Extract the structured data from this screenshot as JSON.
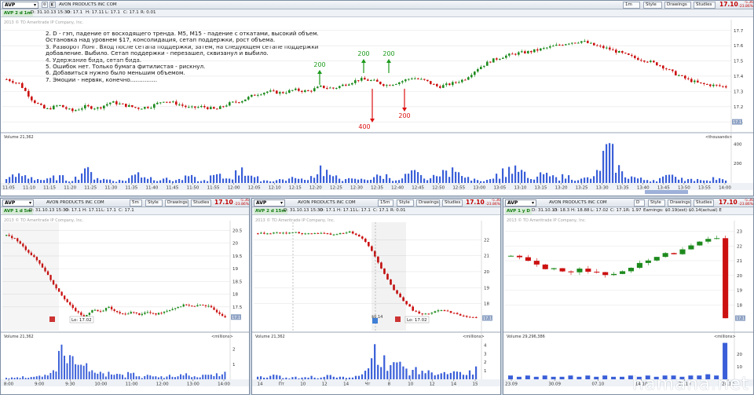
{
  "symbol": "AVP",
  "company": "AVON PRODUCTS INC COM",
  "last_price": "17.10",
  "change": "-5.36",
  "change_pct": "-23.86%",
  "toolbar": {
    "style_label": "Style",
    "drawings_label": "Drawings",
    "studies_label": "Studies"
  },
  "colors": {
    "up": "#1d8a1d",
    "down": "#cc1010",
    "volume": "#3a5fd8",
    "background": "#ffffff",
    "frame": "#c9d3df",
    "annotation_up": "#1a9a1a",
    "annotation_down": "#dd1111"
  },
  "icons": [
    "dropdown-icon",
    "settings-icon",
    "lock-icon",
    "maximize-icon",
    "close-icon",
    "earnings-marker-icon"
  ],
  "main_chart": {
    "timeframe_badge": "AVP 2 d 1m",
    "interval_label": "1m",
    "info": {
      "date": "D: 31.10.13 15:30",
      "open": "O: 17.1",
      "high": "H: 17.11",
      "low": "L: 17.1",
      "close": "C: 17.1",
      "range": "R: 0.01"
    },
    "watermark": "2013 © TD Ameritrade IP Company, Inc.",
    "notes": [
      "2. D - гэп, падение от восходящего тренда. M5, M15 - падение с откатами, высокий объем.",
      "Остановка над уровнем $17, консолидация, сетап поддержки, рост объема.",
      "3. Разворот Лонг. Вход после сетапа поддержки, затем, на следующем сетапе поддержки",
      "добавление. Выбило. Сетап поддержки - перезашел, сквизанул и выбило.",
      "4. Удержание бида, сетап бида.",
      "5. Ошибок нет. Только бумага фитилистая - рискнул.",
      "6. Добавиться нужно было меньшим объемом.",
      "7. Эмоции - нервяк, конечно..............."
    ],
    "annotations": [
      {
        "label": "200",
        "direction": "buy"
      },
      {
        "label": "200",
        "direction": "buy"
      },
      {
        "label": "200",
        "direction": "buy"
      },
      {
        "label": "400",
        "direction": "sell"
      },
      {
        "label": "200",
        "direction": "sell"
      }
    ],
    "volume_label": "Volume 21,362",
    "volume_units": "<thousands>"
  },
  "panel_a": {
    "timeframe_badge": "AVP 1 d 5m",
    "interval_label": "5m",
    "info": {
      "date": "D: 31.10.13 15:30",
      "open": "O: 17.1",
      "high": "H: 17.11",
      "low": "L: 17.1",
      "close": "C: 17.1"
    },
    "watermark": "2013 © TD Ameritrade IP Company, Inc.",
    "low_label": "Lo: 17.02",
    "volume_label": "Volume 21,362",
    "volume_units": "<millions>"
  },
  "panel_b": {
    "timeframe_badge": "AVP 2 d 15m",
    "interval_label": "15m",
    "info": {
      "date": "D: 31.10.13 15:30",
      "open": "O: 17.1",
      "high": "H: 17.11",
      "low": "L: 17.1",
      "close": "C: 17.1",
      "range": "R: 0.01"
    },
    "watermark": "2013 © TD Ameritrade IP Company, Inc.",
    "low_label": "Lo: 17.02",
    "earnings_label": "$0.14",
    "volume_label": "Volume 21,362",
    "volume_units": "<millions>"
  },
  "panel_c": {
    "timeframe_badge": "AVP 1 y D",
    "interval_label": "D",
    "info": {
      "date": "D: 31.10.13",
      "open": "O: 18.3",
      "high": "H: 18.88",
      "low": "L: 17.02",
      "close": "C: 17.1",
      "range": "R: 1.97",
      "earnings": "Earnings: $0.19(est) $0.14(actual) E"
    },
    "watermark": "2013 © TD Ameritrade IP Company, Inc.",
    "volume_label": "Volume 29,296,386",
    "volume_units": "<millions>"
  },
  "brand": "hamana.net",
  "chart_data": [
    {
      "id": "main",
      "type": "candlestick",
      "title": "AVP 2 d 1m",
      "x_ticks": [
        "11:05",
        "11:10",
        "11:15",
        "11:20",
        "11:25",
        "11:30",
        "11:35",
        "11:40",
        "11:45",
        "11:50",
        "11:55",
        "12:00",
        "12:05",
        "12:10",
        "12:15",
        "12:20",
        "12:25",
        "12:30",
        "12:35",
        "12:40",
        "12:45",
        "12:50",
        "12:55",
        "13:00",
        "13:05",
        "13:10",
        "13:15",
        "13:20",
        "13:25",
        "13:30",
        "13:35",
        "13:40",
        "13:45",
        "13:50",
        "13:55",
        "14:00"
      ],
      "y_ticks": [
        17.1,
        17.2,
        17.3,
        17.4,
        17.5,
        17.6,
        17.7
      ],
      "ylim": [
        17.07,
        17.74
      ],
      "last_price_label": "17.1",
      "price_path": [
        17.38,
        17.35,
        17.24,
        17.18,
        17.21,
        17.17,
        17.2,
        17.19,
        17.23,
        17.21,
        17.19,
        17.2,
        17.24,
        17.22,
        17.19,
        17.2,
        17.18,
        17.22,
        17.24,
        17.28,
        17.3,
        17.29,
        17.31,
        17.3,
        17.33,
        17.32,
        17.35,
        17.38,
        17.37,
        17.34,
        17.36,
        17.39,
        17.37,
        17.33,
        17.35,
        17.38,
        17.45,
        17.5,
        17.53,
        17.55,
        17.56,
        17.58,
        17.6,
        17.62,
        17.63,
        17.6,
        17.58,
        17.55,
        17.52,
        17.5,
        17.47,
        17.42,
        17.38,
        17.35,
        17.34,
        17.33
      ],
      "volume_ticks": [
        200,
        400
      ],
      "volume_max": 420,
      "volume": [
        40,
        100,
        60,
        30,
        80,
        20,
        150,
        50,
        35,
        25,
        110,
        60,
        45,
        30,
        70,
        20,
        90,
        45,
        160,
        60,
        25,
        40,
        50,
        30,
        180,
        70,
        40,
        35,
        60,
        90,
        30,
        130,
        45,
        70,
        160,
        55,
        30,
        40,
        150,
        180,
        40,
        90,
        60,
        80,
        45,
        70,
        410,
        120,
        60,
        30,
        50,
        85,
        40,
        30,
        60,
        25
      ]
    },
    {
      "id": "panel_a",
      "type": "candlestick",
      "title": "AVP 1 d 5m",
      "x_ticks": [
        "8:00",
        "9:00",
        "9:30",
        "10:00",
        "11:00",
        "12:00",
        "13:00",
        "14:00"
      ],
      "y_ticks": [
        17.5,
        18,
        18.5,
        19,
        19.5,
        20,
        20.5
      ],
      "ylim": [
        17.0,
        20.7
      ],
      "last_price_label": "17.1",
      "price_path": [
        20.3,
        20.2,
        19.9,
        19.6,
        19.3,
        18.9,
        18.4,
        18.0,
        17.6,
        17.3,
        17.1,
        17.4,
        17.3,
        17.5,
        17.3,
        17.2,
        17.3,
        17.2,
        17.3,
        17.2,
        17.3,
        17.4,
        17.5,
        17.6,
        17.5,
        17.6,
        17.5,
        17.3,
        17.1
      ],
      "volume_ticks": [
        1,
        2
      ],
      "volume": [
        0.1,
        0.1,
        0.2,
        0.1,
        0.2,
        0.3,
        0.6,
        2.3,
        1.6,
        1.0,
        0.9,
        0.6,
        0.5,
        0.5,
        0.3,
        0.3,
        0.4,
        0.2,
        0.3,
        0.2,
        0.2,
        0.3,
        0.2,
        0.4,
        0.2,
        0.3,
        0.3,
        0.4,
        0.5
      ]
    },
    {
      "id": "panel_b",
      "type": "candlestick",
      "title": "AVP 2 d 15m",
      "x_ticks": [
        "14",
        "Пт",
        "10",
        "12",
        "14",
        "Чт",
        "8",
        "10",
        "12",
        "14",
        "15"
      ],
      "y_ticks": [
        18,
        19,
        20,
        21,
        22
      ],
      "ylim": [
        17.0,
        22.9
      ],
      "last_price_label": "17.1",
      "price_path": [
        22.4,
        22.4,
        22.45,
        22.4,
        22.5,
        22.35,
        22.4,
        22.45,
        22.3,
        22.4,
        22.5,
        22.3,
        21.8,
        20.8,
        19.8,
        18.8,
        18.2,
        17.6,
        17.3,
        17.4,
        17.6,
        17.5,
        17.3,
        17.2,
        17.1
      ],
      "volume_ticks": [
        1,
        2,
        3,
        4
      ],
      "volume": [
        0.3,
        0.2,
        0.5,
        0.2,
        0.3,
        0.2,
        0.4,
        0.2,
        0.5,
        0.3,
        0.2,
        0.4,
        1.0,
        4.1,
        2.8,
        2.0,
        1.5,
        1.1,
        1.0,
        0.8,
        0.7,
        0.6,
        0.9,
        0.5,
        1.5
      ]
    },
    {
      "id": "panel_c",
      "type": "candlestick",
      "title": "AVP 1 y D",
      "x_ticks": [
        "23.09",
        "30.09",
        "07.10",
        "14.10",
        "21.10",
        "28.10"
      ],
      "y_ticks": [
        18,
        19,
        20,
        21,
        22,
        23
      ],
      "ylim": [
        17.0,
        23.4
      ],
      "last_price_label": "17.1",
      "price_path": [
        21.3,
        21.2,
        21.0,
        20.7,
        20.4,
        20.5,
        20.3,
        20.2,
        20.5,
        20.3,
        20.2,
        20.0,
        20.1,
        20.3,
        20.5,
        20.8,
        21.0,
        21.3,
        21.5,
        21.4,
        21.8,
        22.0,
        22.3,
        22.5,
        22.5,
        17.1
      ],
      "volume_ticks": [
        10,
        20
      ],
      "volume": [
        3,
        2,
        3,
        2,
        3,
        2,
        2,
        3,
        2,
        3,
        2,
        3,
        2,
        2,
        3,
        2,
        3,
        2,
        3,
        3,
        2,
        3,
        3,
        4,
        3,
        29
      ]
    }
  ]
}
